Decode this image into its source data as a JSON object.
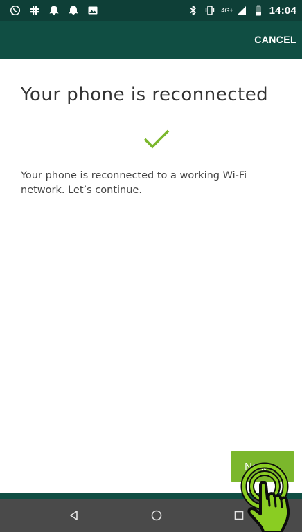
{
  "status_bar": {
    "left_icons": [
      "whatsapp-icon",
      "slack-icon",
      "ghost-icon",
      "ghost-icon",
      "image-icon"
    ],
    "right_icons": [
      "bluetooth-icon",
      "vibrate-icon",
      "signal-icon",
      "battery-icon"
    ],
    "network_label": "4G+",
    "time": "14:04"
  },
  "action_bar": {
    "cancel_label": "CANCEL"
  },
  "content": {
    "title": "Your phone is reconnected",
    "check_icon": "checkmark-icon",
    "body": "Your phone is reconnected to a working Wi-Fi network. Let’s continue."
  },
  "next_button": {
    "label": "Next",
    "arrow": "→"
  },
  "nav_bar": {
    "icons": [
      "back-icon",
      "home-icon",
      "recents-icon"
    ]
  },
  "colors": {
    "status_bar": "#0e3f37",
    "action_bar": "#104e43",
    "accent_green": "#7bb72c",
    "nav_bar": "#4a4a4a"
  }
}
